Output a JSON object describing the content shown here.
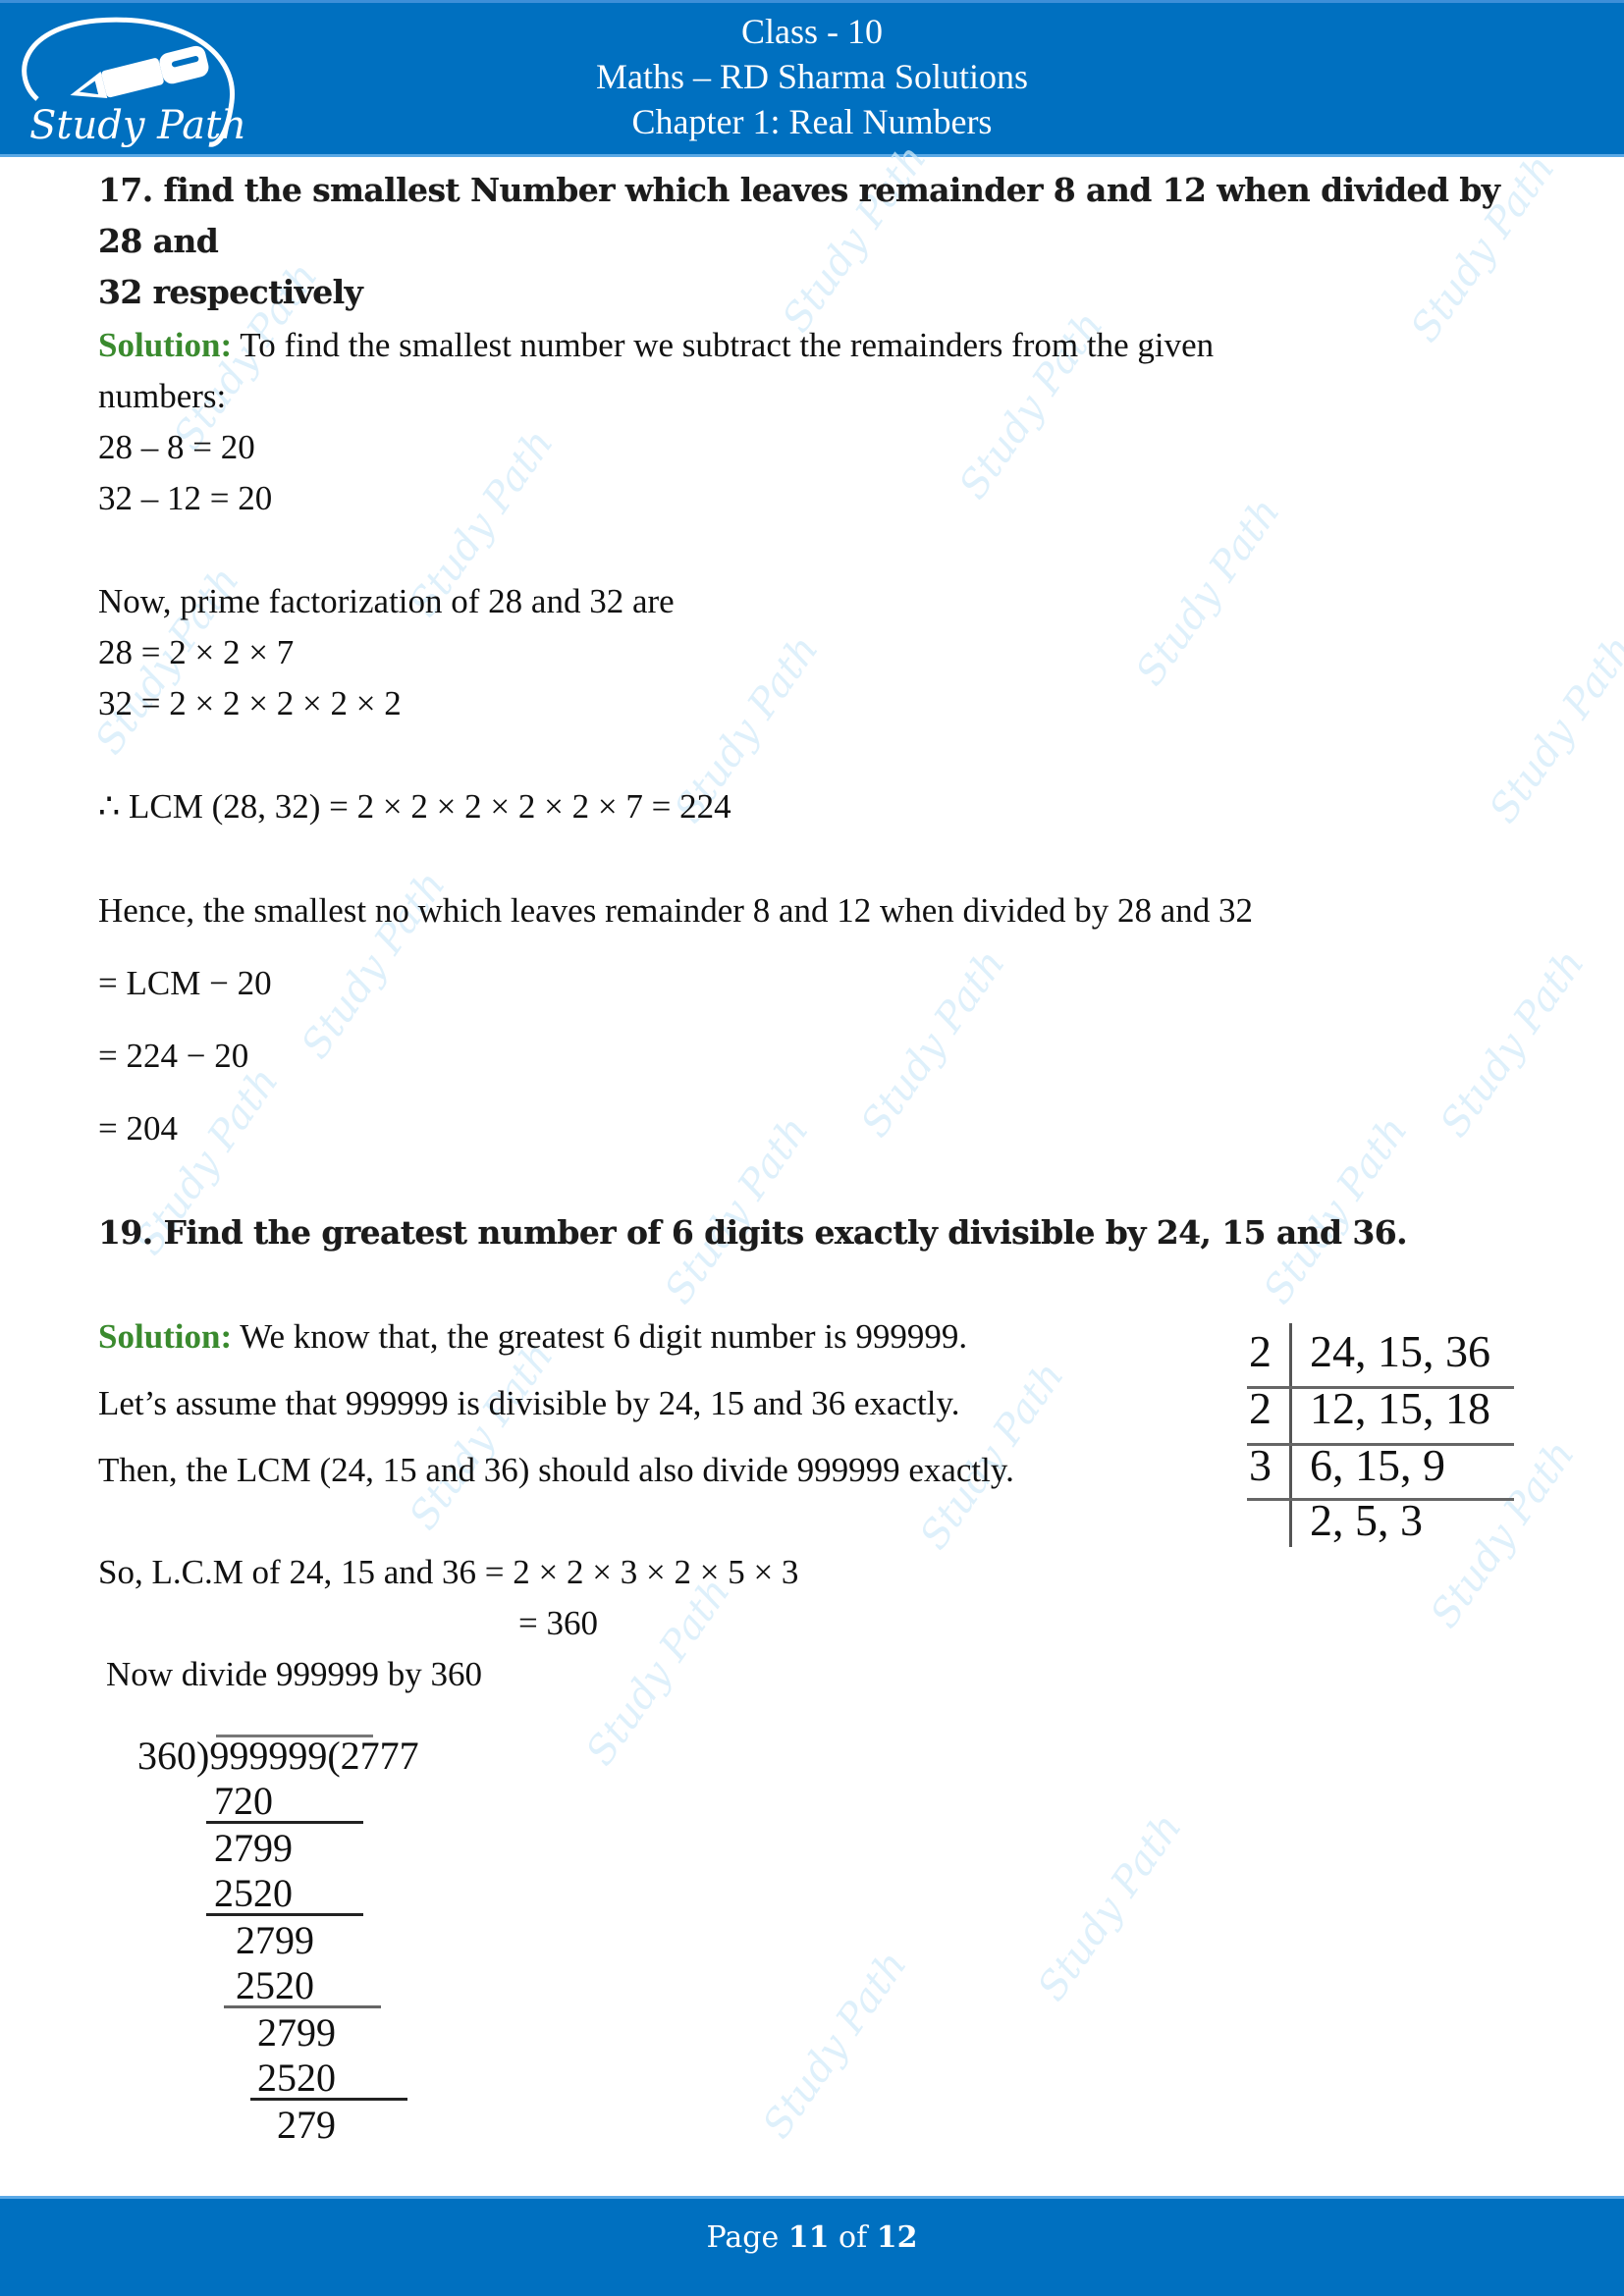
{
  "header": {
    "logo_text": "Study Path",
    "line1": "Class - 10",
    "line2": "Maths – RD Sharma Solutions",
    "line3": "Chapter 1: Real Numbers"
  },
  "watermark_text": "Study Path",
  "q17": {
    "question_line1": "17. find the smallest Number which leaves remainder 8 and 12 when divided by 28 and",
    "question_line2": "32 respectively",
    "solution_label": "Solution:",
    "solution_intro": " To find the smallest number we subtract the remainders from the given",
    "solution_intro2": "numbers:",
    "eq1": "28 – 8 = 20",
    "eq2": "32 – 12 = 20",
    "prime_intro": "Now, prime factorization  of 28 and 32 are",
    "pf1": "28 = 2 × 2 × 7",
    "pf2": "32 = 2 × 2 × 2 × 2 × 2",
    "lcm": "∴ LCM (28, 32) = 2 × 2 × 2 × 2 × 2 × 7 = 224",
    "hence": "Hence, the smallest no which leaves remainder 8 and 12 when divided by 28 and 32",
    "step1": "= LCM − 20",
    "step2": "= 224 − 20",
    "step3": "= 204"
  },
  "q19": {
    "question": "19. Find the greatest number of 6 digits exactly divisible by 24, 15 and 36.",
    "solution_label": "Solution:",
    "line1": " We know that, the greatest 6 digit number is 999999.",
    "line2": "Let’s assume that 999999 is divisible by 24, 15 and 36 exactly.",
    "line3": "Then, the LCM (24, 15 and 36) should also divide 999999 exactly.",
    "lcm_line": "So, L.C.M of 24, 15 and 36 = 2 × 2 × 3 × 2 × 5 × 3",
    "lcm_result": "= 360",
    "divide_line": "Now divide 999999 by 360",
    "division_table": [
      {
        "divisor": "2",
        "numbers": "24, 15, 36"
      },
      {
        "divisor": "2",
        "numbers": "12, 15, 18"
      },
      {
        "divisor": "3",
        "numbers": "6, 15, 9"
      },
      {
        "divisor": "",
        "numbers": "2, 5, 3"
      }
    ],
    "long_division": {
      "header": "360)999999(2777",
      "steps": [
        "720",
        "2799",
        "2520",
        "2799",
        "2520",
        "2799",
        "2520",
        "279"
      ]
    }
  },
  "footer": {
    "page_prefix": "Page ",
    "page_current": "11",
    "page_of": " of ",
    "page_total": "12"
  }
}
